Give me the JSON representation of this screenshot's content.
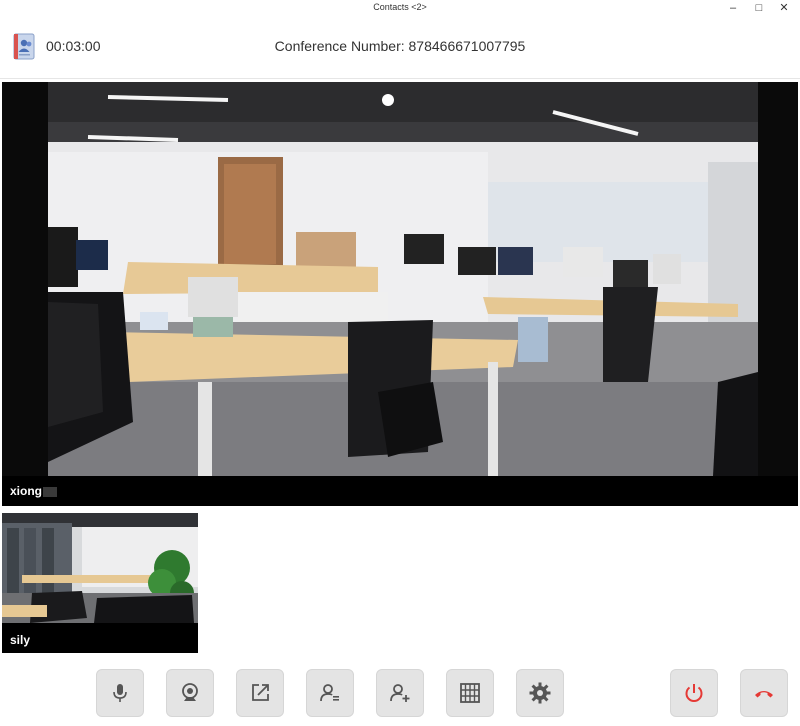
{
  "window": {
    "title": "Contacts <2>",
    "minimize_glyph": "–",
    "maximize_glyph": "□",
    "close_glyph": "✕"
  },
  "header": {
    "timer": "00:03:00",
    "conference_number": "Conference Number: 878466671007795",
    "app_icon": "contacts-book-icon"
  },
  "main_video": {
    "participant": "xiong"
  },
  "thumbnails": [
    {
      "participant": "sily"
    }
  ],
  "toolbar": {
    "buttons": [
      {
        "icon": "microphone-icon"
      },
      {
        "icon": "camera-icon"
      },
      {
        "icon": "share-screen-icon"
      },
      {
        "icon": "manage-participants-icon"
      },
      {
        "icon": "add-participant-icon"
      },
      {
        "icon": "grid-layout-icon"
      },
      {
        "icon": "settings-icon"
      },
      {
        "icon": "power-icon",
        "color": "#e53935"
      },
      {
        "icon": "hang-up-icon",
        "color": "#e53935"
      }
    ]
  },
  "colors": {
    "accent_red": "#e53935",
    "icon_gray": "#555555",
    "button_bg": "#e4e4e4"
  }
}
